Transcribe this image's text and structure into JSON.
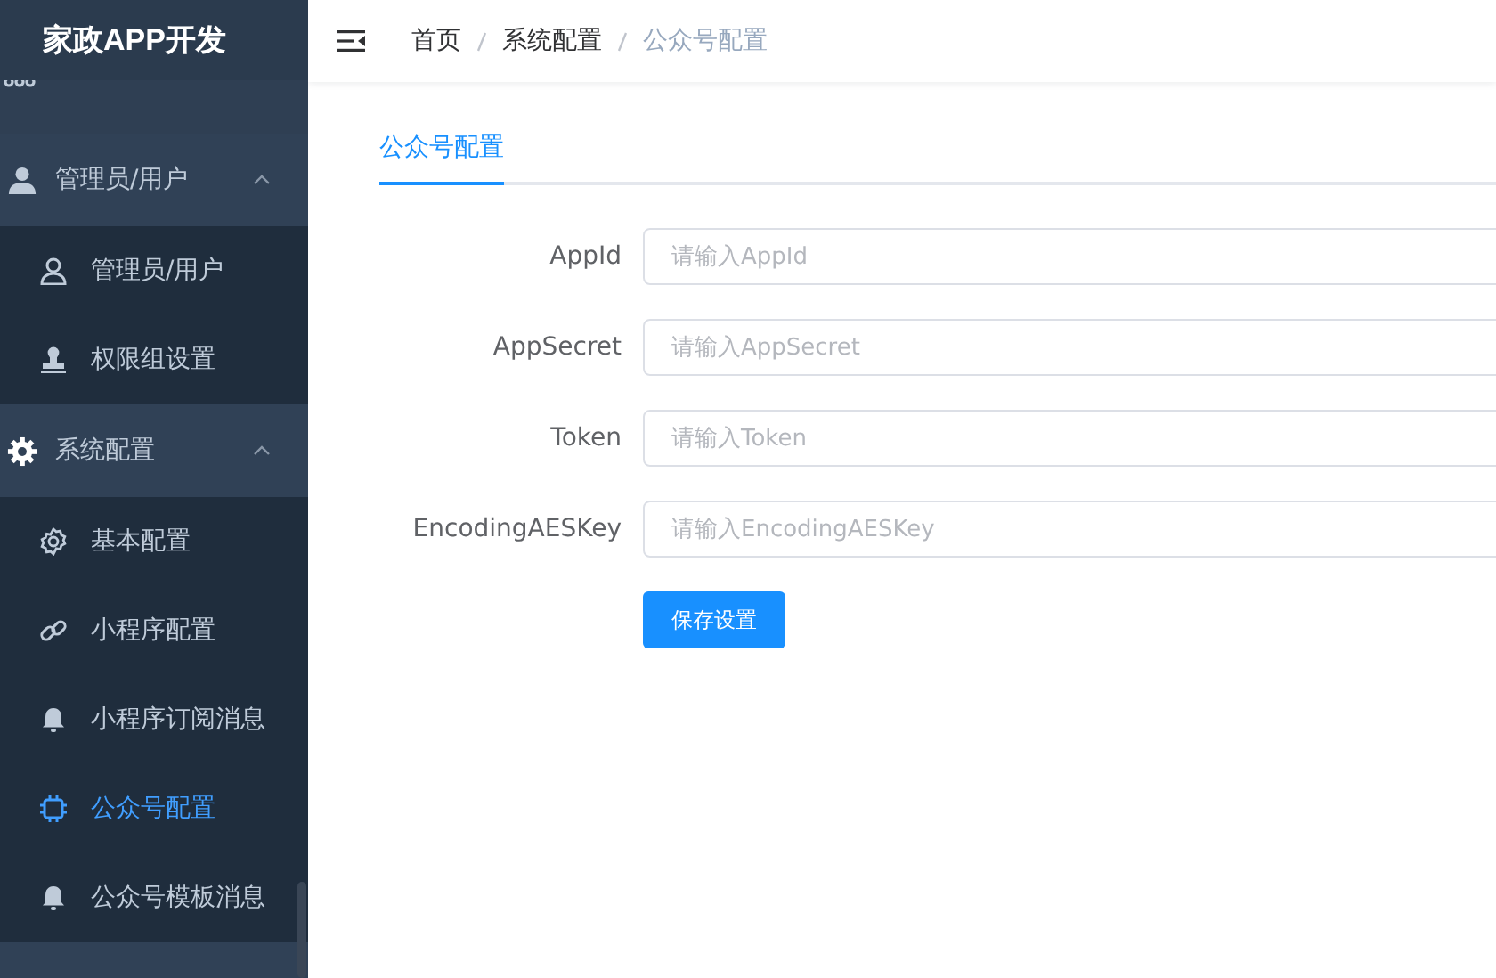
{
  "sidebar": {
    "logo": "家政APP开发",
    "groups": [
      {
        "label": "管理员/用户",
        "kind": "person",
        "expanded": true,
        "children": [
          {
            "label": "管理员/用户",
            "kind": "user",
            "selected": false
          },
          {
            "label": "权限组设置",
            "kind": "stamp",
            "selected": false
          }
        ]
      },
      {
        "label": "系统配置",
        "kind": "gear",
        "expanded": true,
        "children": [
          {
            "label": "基本配置",
            "kind": "settings",
            "selected": false
          },
          {
            "label": "小程序配置",
            "kind": "link",
            "selected": false
          },
          {
            "label": "小程序订阅消息",
            "kind": "bell",
            "selected": false
          },
          {
            "label": "公众号配置",
            "kind": "chip",
            "selected": true
          },
          {
            "label": "公众号模板消息",
            "kind": "bell",
            "selected": false
          }
        ]
      }
    ]
  },
  "breadcrumb": [
    "首页",
    "系统配置",
    "公众号配置"
  ],
  "tabs": [
    {
      "label": "公众号配置",
      "selected": true
    }
  ],
  "form": {
    "fields": [
      {
        "label": "AppId",
        "placeholder": "请输入AppId"
      },
      {
        "label": "AppSecret",
        "placeholder": "请输入AppSecret"
      },
      {
        "label": "Token",
        "placeholder": "请输入Token"
      },
      {
        "label": "EncodingAESKey",
        "placeholder": "请输入EncodingAESKey"
      }
    ],
    "submit": "保存设置"
  }
}
